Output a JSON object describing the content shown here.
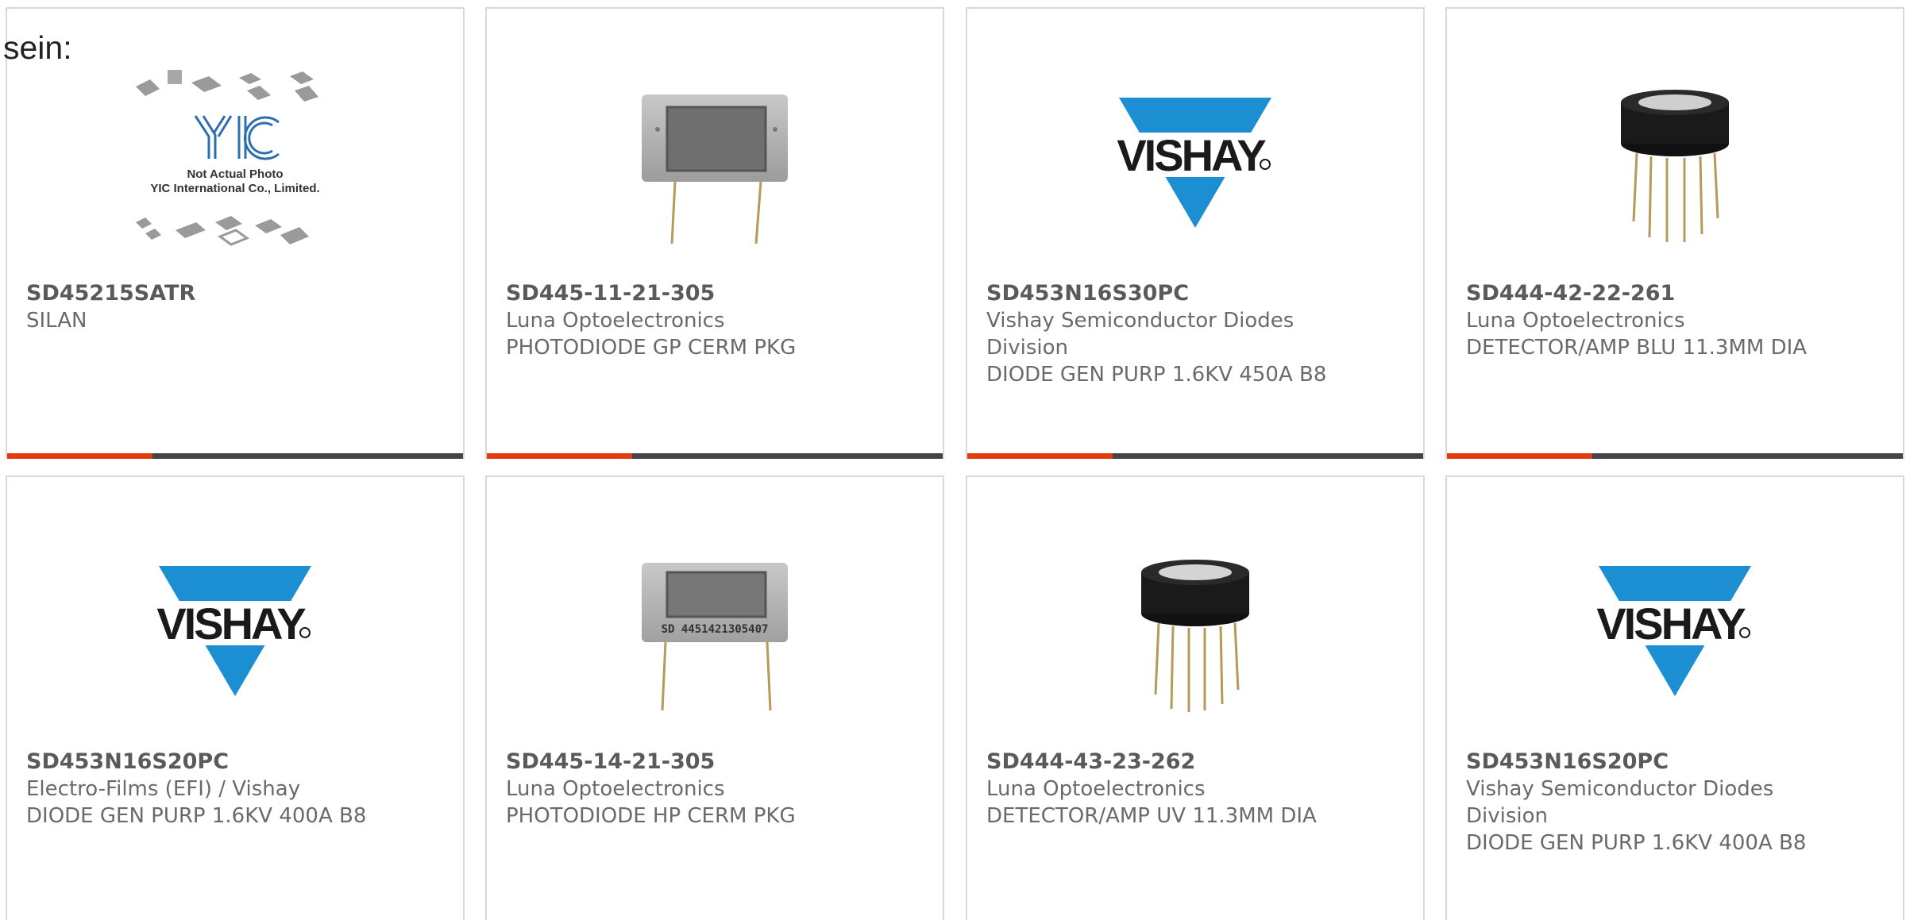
{
  "page_label": "sein:",
  "colors": {
    "accent_red": "#e23a12",
    "accent_dark": "#444444",
    "vishay_blue": "#1b8fd2"
  },
  "products": [
    {
      "part": "SD45215SATR",
      "lines": [
        "SILAN"
      ],
      "image": "yic-placeholder-image",
      "placeholder": {
        "brand": "YIC",
        "line1": "Not Actual Photo",
        "line2": "YIC International Co., Limited."
      }
    },
    {
      "part": "SD445-11-21-305",
      "lines": [
        "Luna Optoelectronics",
        "PHOTODIODE GP CERM PKG"
      ],
      "image": "ceramic-photodiode-image"
    },
    {
      "part": "SD453N16S30PC",
      "lines": [
        "Vishay Semiconductor Diodes",
        "Division",
        "DIODE GEN PURP 1.6KV 450A B8"
      ],
      "image": "vishay-logo",
      "logo_text": "VISHAY"
    },
    {
      "part": "SD444-42-22-261",
      "lines": [
        "Luna Optoelectronics",
        "DETECTOR/AMP BLU 11.3MM DIA"
      ],
      "image": "to-can-detector-image"
    },
    {
      "part": "SD453N16S20PC",
      "lines": [
        "Electro-Films (EFI) / Vishay",
        "DIODE GEN PURP 1.6KV 400A B8"
      ],
      "image": "vishay-logo",
      "logo_text": "VISHAY"
    },
    {
      "part": "SD445-14-21-305",
      "lines": [
        "Luna Optoelectronics",
        "PHOTODIODE HP CERM PKG"
      ],
      "image": "ceramic-photodiode-image",
      "marking": "SD 4451421305407"
    },
    {
      "part": "SD444-43-23-262",
      "lines": [
        "Luna Optoelectronics",
        "DETECTOR/AMP UV 11.3MM DIA"
      ],
      "image": "to-can-detector-image"
    },
    {
      "part": "SD453N16S20PC",
      "lines": [
        "Vishay Semiconductor Diodes",
        "Division",
        "DIODE GEN PURP 1.6KV 400A B8"
      ],
      "image": "vishay-logo",
      "logo_text": "VISHAY"
    }
  ]
}
